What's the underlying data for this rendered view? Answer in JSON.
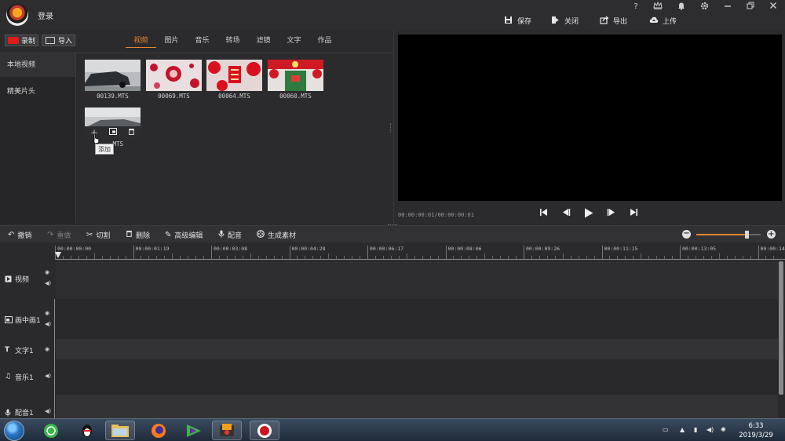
{
  "titlebar": {
    "login_label": "登录",
    "help": "?",
    "save": "保存",
    "close": "关闭",
    "export": "导出",
    "upload": "上传"
  },
  "library": {
    "record_label": "录制",
    "import_label": "导入",
    "tabs": [
      {
        "label": "视频",
        "active": true
      },
      {
        "label": "图片",
        "active": false
      },
      {
        "label": "音乐",
        "active": false
      },
      {
        "label": "转场",
        "active": false
      },
      {
        "label": "滤镜",
        "active": false
      },
      {
        "label": "文字",
        "active": false
      },
      {
        "label": "作品",
        "active": false
      }
    ],
    "side_items": [
      {
        "label": "本地视频",
        "active": true
      },
      {
        "label": "精美片头",
        "active": false
      }
    ],
    "thumbnails": [
      {
        "label": "00139.MTS",
        "scene": "car"
      },
      {
        "label": "00069.MTS",
        "scene": "red-decor"
      },
      {
        "label": "00064.MTS",
        "scene": "double-happiness"
      },
      {
        "label": "00060.MTS",
        "scene": "red-door"
      },
      {
        "label": ".MTS",
        "scene": "street"
      }
    ],
    "tooltip": "添加"
  },
  "preview": {
    "time": "00:00:00:01/00:00:00:01"
  },
  "toolbar": {
    "undo": "撤销",
    "redo": "重做",
    "cut": "切割",
    "delete": "删除",
    "advanced_edit": "高级编辑",
    "dub": "配音",
    "generate": "生成素材",
    "zoom_level": 0.78
  },
  "timeline": {
    "ticks": [
      "00:00:00:00",
      "00:00:01:19",
      "00:00:03:08",
      "00:00:04:28",
      "00:00:06:17",
      "00:00:08:06",
      "00:00:09:26",
      "00:00:11:15",
      "00:00:13:05",
      "00:00:14:"
    ],
    "tracks": [
      {
        "label": "视频",
        "icon": "play-icon",
        "eye": true,
        "vol": true
      },
      {
        "label": "画中画1",
        "icon": "pip-icon",
        "eye": true,
        "vol": true
      },
      {
        "label": "文字1",
        "icon": "text-icon",
        "eye": true,
        "vol": false
      },
      {
        "label": "音乐1",
        "icon": "music-icon",
        "eye": false,
        "vol": true
      },
      {
        "label": "配音1",
        "icon": "mic-icon",
        "eye": false,
        "vol": true
      }
    ]
  },
  "taskbar": {
    "time": "6:33",
    "date": "2019/3/29"
  },
  "colors": {
    "accent": "#e8832a",
    "record": "#e01b1b"
  }
}
